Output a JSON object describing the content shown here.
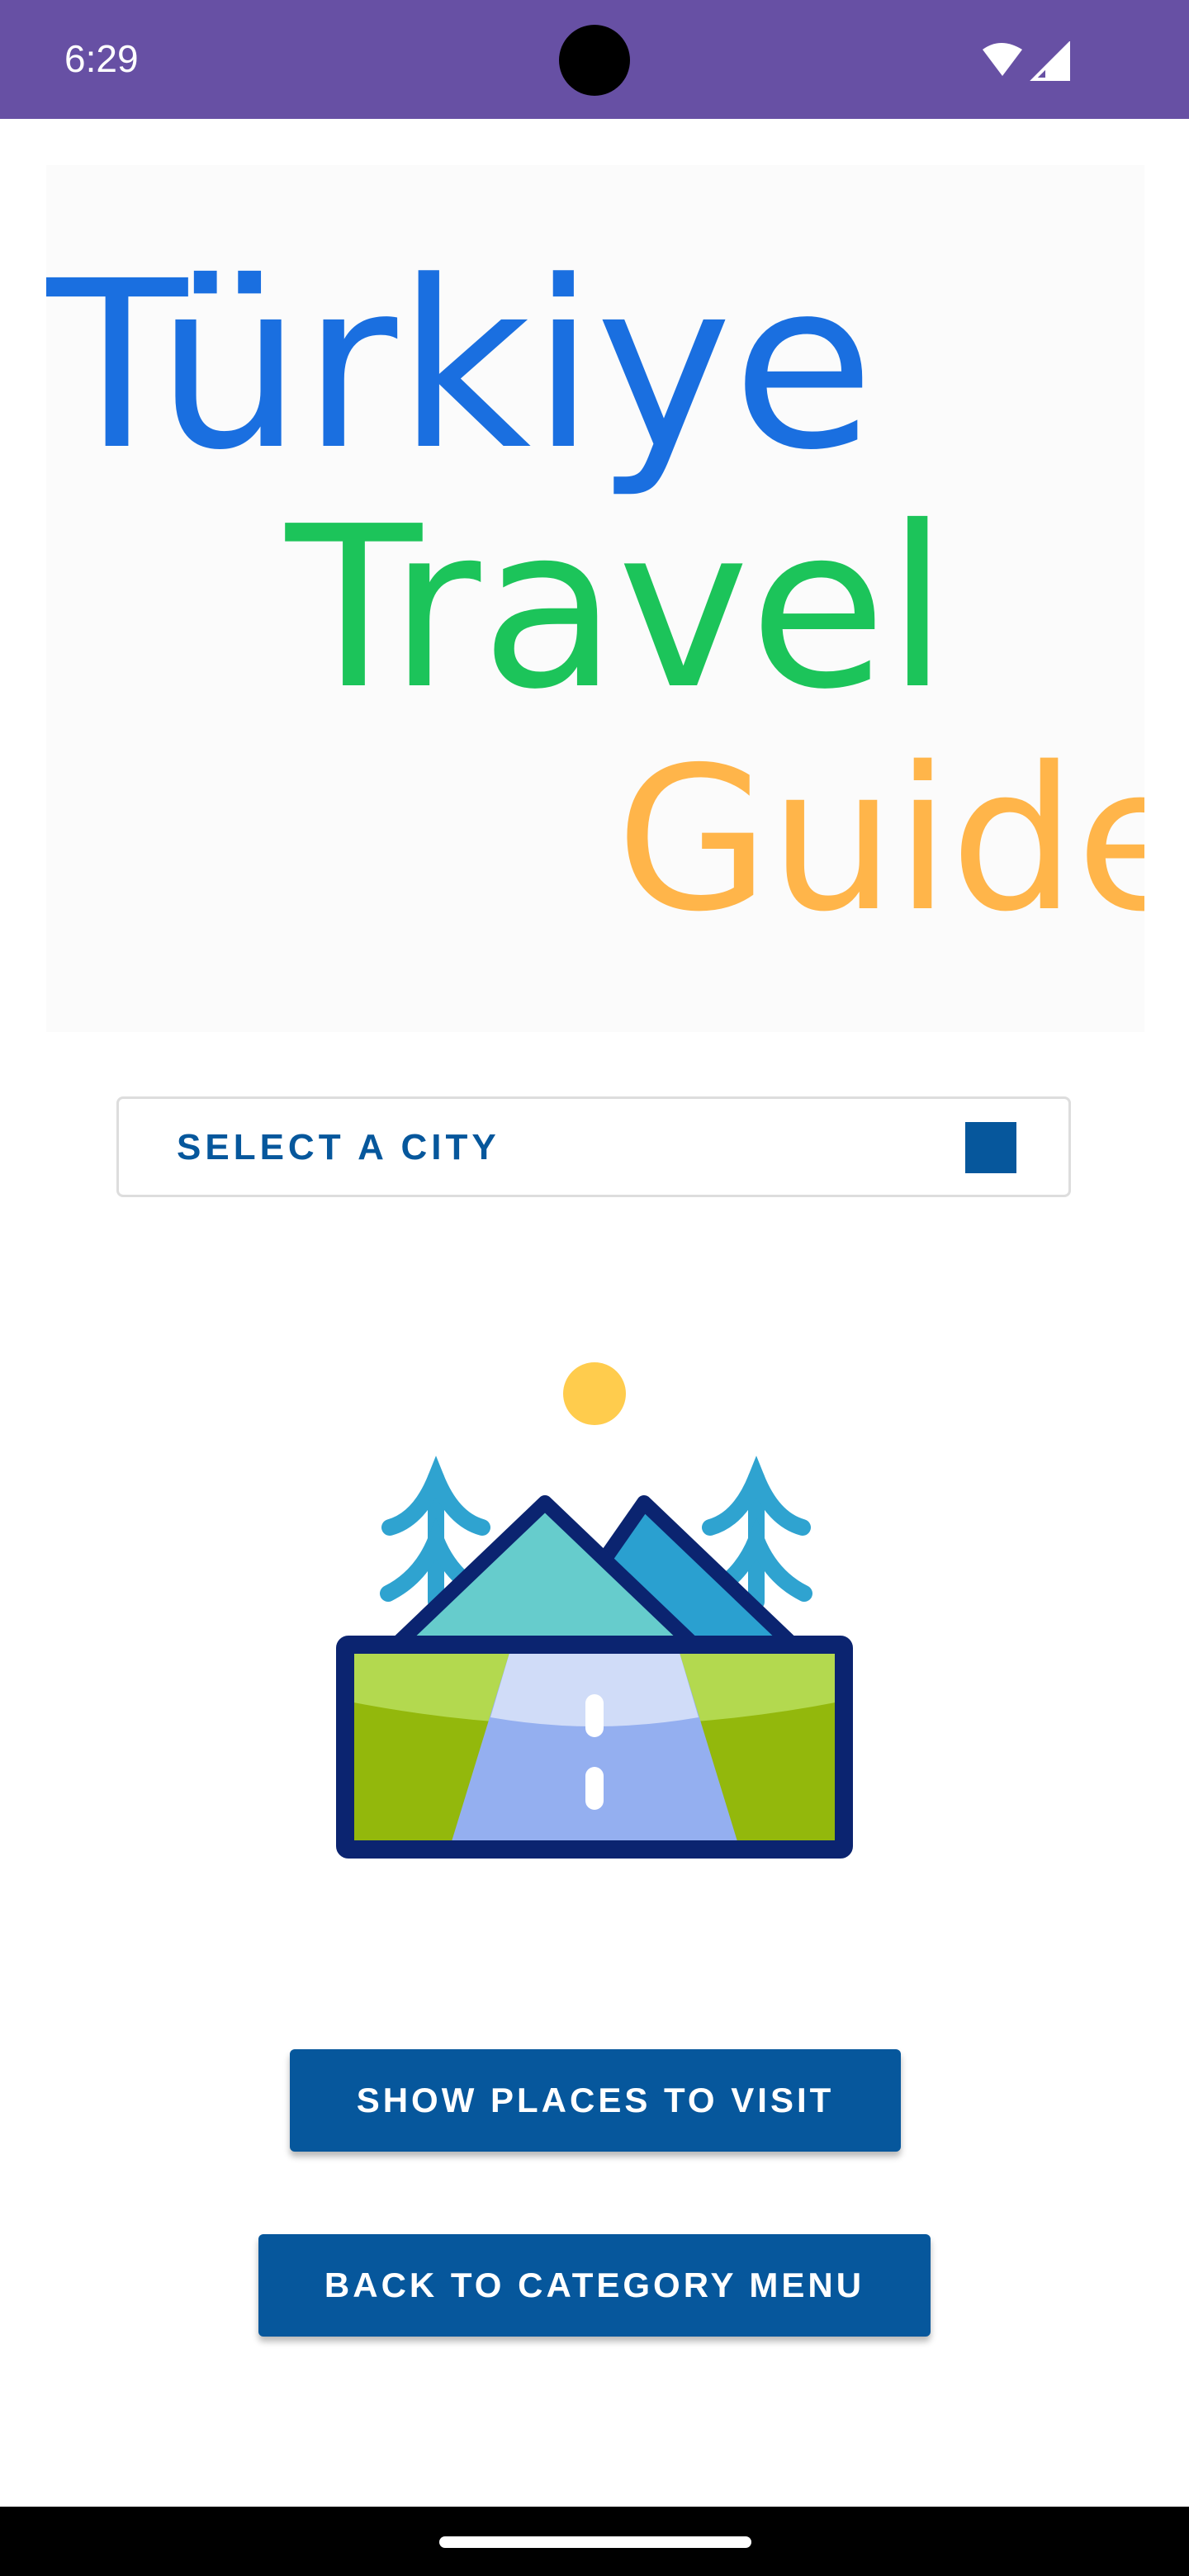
{
  "status_bar": {
    "time": "6:29"
  },
  "logo": {
    "line1": "Türkiye",
    "line2": "Travel",
    "line3": "Guide",
    "colors": {
      "line1": "#1a6fe0",
      "line2": "#1cc45a",
      "line3": "#ffb54a"
    }
  },
  "city_spinner": {
    "label": "SELECT A CITY"
  },
  "illustration": {
    "icon": "landscape-road-icon"
  },
  "buttons": {
    "show_places": "SHOW PLACES TO VISIT",
    "back_to_category": "BACK TO CATEGORY MENU"
  },
  "colors": {
    "status_bar": "#6750a4",
    "primary": "#06579c"
  }
}
